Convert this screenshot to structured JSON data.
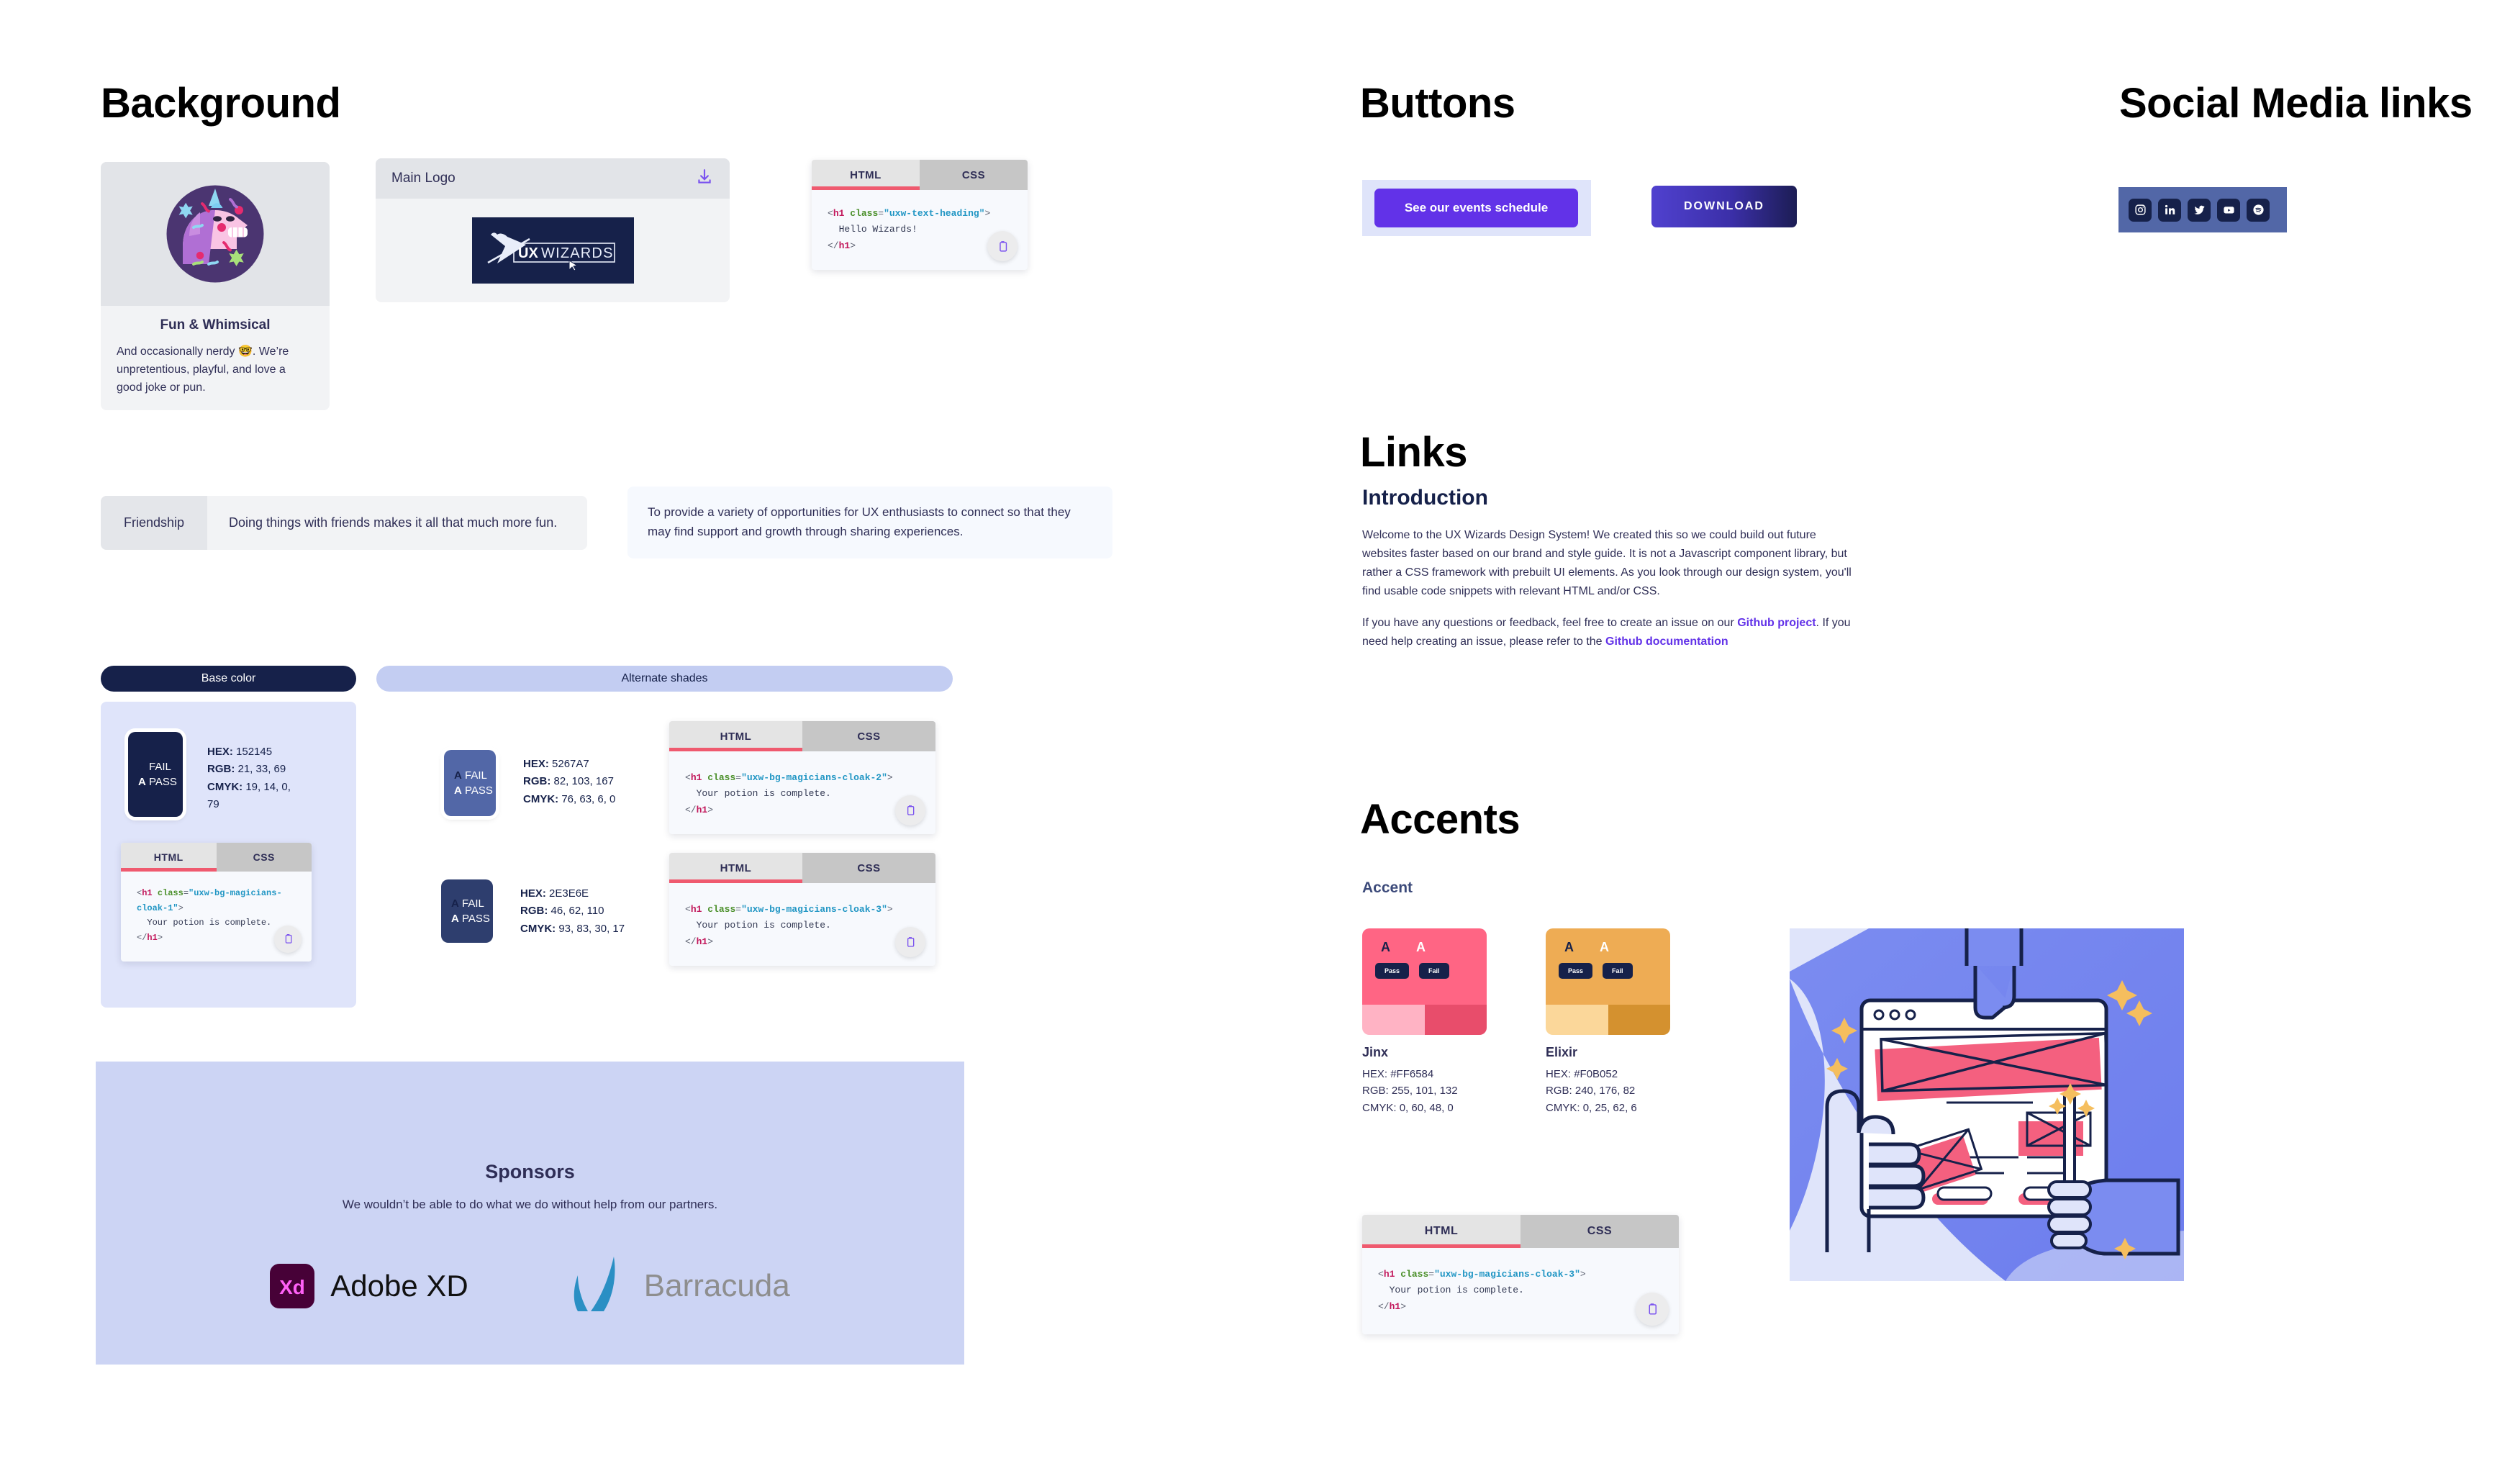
{
  "sections": {
    "background": "Background",
    "buttons": "Buttons",
    "social": "Social Media links",
    "links": "Links",
    "accents": "Accents"
  },
  "fun_card": {
    "title": "Fun & Whimsical",
    "body": "And occasionally nerdy 🤓. We’re unpretentious, playful, and love a good joke or pun.",
    "image_name": "unicorn-illustration"
  },
  "logo_card": {
    "label": "Main Logo",
    "download_icon": "download-icon",
    "logo_text_bold": "UX",
    "logo_text_light": "WIZARDS"
  },
  "code_blocks": {
    "tab_html": "HTML",
    "tab_css": "CSS",
    "copy_icon": "clipboard-icon",
    "heading": {
      "tag_open": "<h1 ",
      "attr": "class",
      "eq": "=",
      "value": "\"uxw-text-heading\"",
      "gt": ">",
      "content": "  Hello Wizards!",
      "tag_close": "</h1>"
    },
    "cloak1": {
      "value": "\"uxw-bg-magicians-cloak-1\"",
      "content": "  Your potion is complete."
    },
    "cloak2": {
      "value": "\"uxw-bg-magicians-cloak-2\"",
      "content": "  Your potion is complete."
    },
    "cloak3": {
      "value": "\"uxw-bg-magicians-cloak-3\"",
      "content": "  Your potion is complete."
    },
    "cloak3b": {
      "value": "\"uxw-bg-magicians-cloak-3\"",
      "content": "  Your potion is complete."
    }
  },
  "friendship": {
    "key": "Friendship",
    "value": "Doing things with friends makes it all that much more fun."
  },
  "mission": {
    "text": "To provide a variety of opportunities for UX enthusiasts to connect so that they may find support and growth through sharing experiences."
  },
  "color_tabs": {
    "base": "Base color",
    "alternate": "Alternate shades"
  },
  "colors": {
    "base": {
      "hex_label": "HEX:",
      "hex": "152145",
      "rgb_label": "RGB:",
      "rgb": "21, 33, 69",
      "cmyk_label": "CMYK:",
      "cmyk": "19, 14, 0, 79",
      "swatch_hex": "#16214a",
      "fail": "FAIL",
      "pass": "PASS",
      "a": "A"
    },
    "alt1": {
      "hex_label": "HEX:",
      "hex": "5267A7",
      "rgb_label": "RGB:",
      "rgb": "82, 103, 167",
      "cmyk_label": "CMYK:",
      "cmyk": "76, 63, 6, 0",
      "swatch_hex": "#5267a7",
      "fail": "FAIL",
      "pass": "PASS",
      "a": "A"
    },
    "alt2": {
      "hex_label": "HEX:",
      "hex": "2E3E6E",
      "rgb_label": "RGB:",
      "rgb": "46, 62, 110",
      "cmyk_label": "CMYK:",
      "cmyk": "93, 83, 30, 17",
      "swatch_hex": "#2e3e6e",
      "fail": "FAIL",
      "pass": "PASS",
      "a": "A"
    }
  },
  "sponsors": {
    "title": "Sponsors",
    "subtitle": "We wouldn’t be able to do what we do without help from our partners.",
    "logos": [
      "Adobe XD",
      "Barracuda"
    ]
  },
  "buttons": {
    "events": "See our events schedule",
    "download": "DOWNLOAD"
  },
  "social_links": [
    {
      "name": "instagram-icon"
    },
    {
      "name": "linkedin-icon"
    },
    {
      "name": "twitter-icon"
    },
    {
      "name": "youtube-icon"
    },
    {
      "name": "spotify-icon"
    }
  ],
  "links_section": {
    "heading": "Introduction",
    "p1": "Welcome to the UX Wizards Design System! We created this so we could build out future websites faster based on our brand and style guide. It is not a Javascript component library, but rather a CSS framework with prebuilt UI elements. As you look through our design system, you'll find usable code snippets with relevant HTML and/or CSS.",
    "p2_before": "If you have any questions or feedback, feel free to create an issue on our ",
    "link1": "Github project",
    "p2_mid": ". If you need help creating an issue, please refer to the ",
    "link2": "Github documentation"
  },
  "accents": {
    "label": "Accent",
    "items": [
      {
        "name": "Jinx",
        "hex_label": "HEX:",
        "hex": "#FF6584",
        "rgb_label": "RGB:",
        "rgb": "255, 101, 132",
        "cmyk_label": "CMYK:",
        "cmyk": "0, 60,  48, 0",
        "color": "#ff6584",
        "light": "#ffb3c4",
        "dark": "#e84d6b",
        "a": "A",
        "pass": "Pass",
        "fail": "Fail"
      },
      {
        "name": "Elixir",
        "hex_label": "HEX:",
        "hex": "#F0B052",
        "rgb_label": "RGB:",
        "rgb": "240, 176, 82",
        "cmyk_label": "CMYK:",
        "cmyk": "0, 25, 62, 6",
        "color": "#eeac54",
        "light": "#fbd79a",
        "dark": "#d4912f",
        "a": "A",
        "pass": "Pass",
        "fail": "Fail"
      }
    ]
  },
  "illustration": {
    "name": "web-design-hands-illustration"
  }
}
